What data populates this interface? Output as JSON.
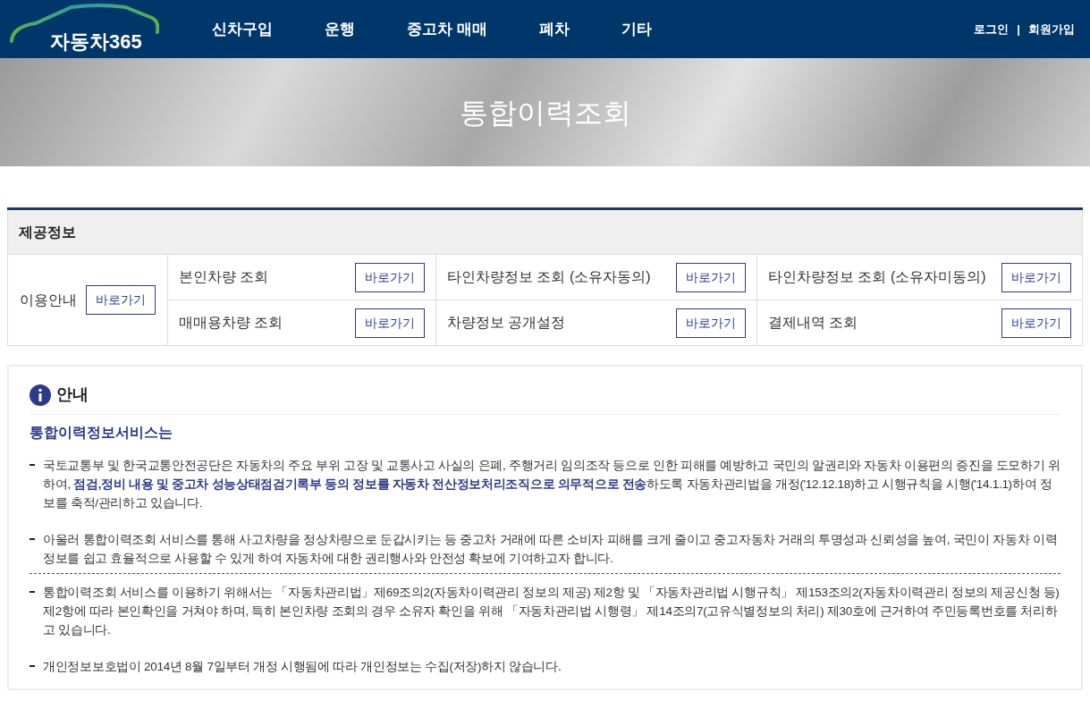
{
  "header": {
    "logo": "자동차365",
    "nav": [
      {
        "label": "신차구입"
      },
      {
        "label": "운행"
      },
      {
        "label": "중고차 매매"
      },
      {
        "label": "폐차"
      },
      {
        "label": "기타"
      }
    ],
    "login": "로그인",
    "separator": "|",
    "signup": "회원가입"
  },
  "banner": {
    "title": "통합이력조회"
  },
  "info_table": {
    "title": "제공정보",
    "guide": {
      "label": "이용안내",
      "button": "바로가기"
    },
    "items": [
      {
        "label": "본인차량 조회",
        "button": "바로가기"
      },
      {
        "label": "타인차량정보 조회 (소유자동의)",
        "button": "바로가기"
      },
      {
        "label": "타인차량정보 조회 (소유자미동의)",
        "button": "바로가기"
      },
      {
        "label": "매매용차량 조회",
        "button": "바로가기"
      },
      {
        "label": "차량정보 공개설정",
        "button": "바로가기"
      },
      {
        "label": "결제내역 조회",
        "button": "바로가기"
      }
    ]
  },
  "notice": {
    "title": "안내",
    "subtitle": "통합이력정보서비스는",
    "paragraphs": [
      {
        "text": "국토교통부 및 한국교통안전공단은 자동차의 주요 부위 고장 및 교통사고 사실의 은폐, 주행거리 임의조작 등으로 인한 피해를 예방하고 국민의 알권리와 자동차 이용편의 증진을 도모하기 위하여, **점검,정비 내용 및 중고차 성능상태점검기록부 등의 정보를 자동차 전산정보처리조직으로 의무적으로 전송**하도록 자동차관리법을 개정('12.12.18)하고 시행규칙을 시행('14.1.1)하여 정보를 축적/관리하고 있습니다.",
        "divider_after": false
      },
      {
        "text": "아울러 통합이력조회 서비스를 통해 사고차량을 정상차량으로 둔갑시키는 등 중고차 거래에 따른 소비자 피해를 크게 줄이고 중고자동차 거래의 투명성과 신뢰성을 높여, 국민이 자동차 이력정보를 쉽고 효율적으로 사용할 수 있게 하여 자동차에 대한 권리행사와 안전성 확보에 기여하고자 합니다.",
        "divider_after": true
      },
      {
        "text": "통합이력조회 서비스를 이용하기 위해서는 「자동차관리법」제69조의2(자동차이력관리 정보의 제공) 제2항 및 「자동차관리법 시행규칙」 제153조의2(자동차이력관리 정보의 제공신청 등)제2항에 따라 본인확인을 거쳐야 하며, 특히 본인차량 조회의 경우 소유자 확인을 위해 「자동차관리법 시행령」 제14조의7(고유식별정보의 처리) 제30호에 근거하여 주민등록번호를 처리하고 있습니다.",
        "divider_after": false
      },
      {
        "text": "개인정보보호법이 2014년 8월 7일부터 개정 시행됨에 따라 개인정보는 수집(저장)하지 않습니다.",
        "divider_after": false
      }
    ]
  }
}
